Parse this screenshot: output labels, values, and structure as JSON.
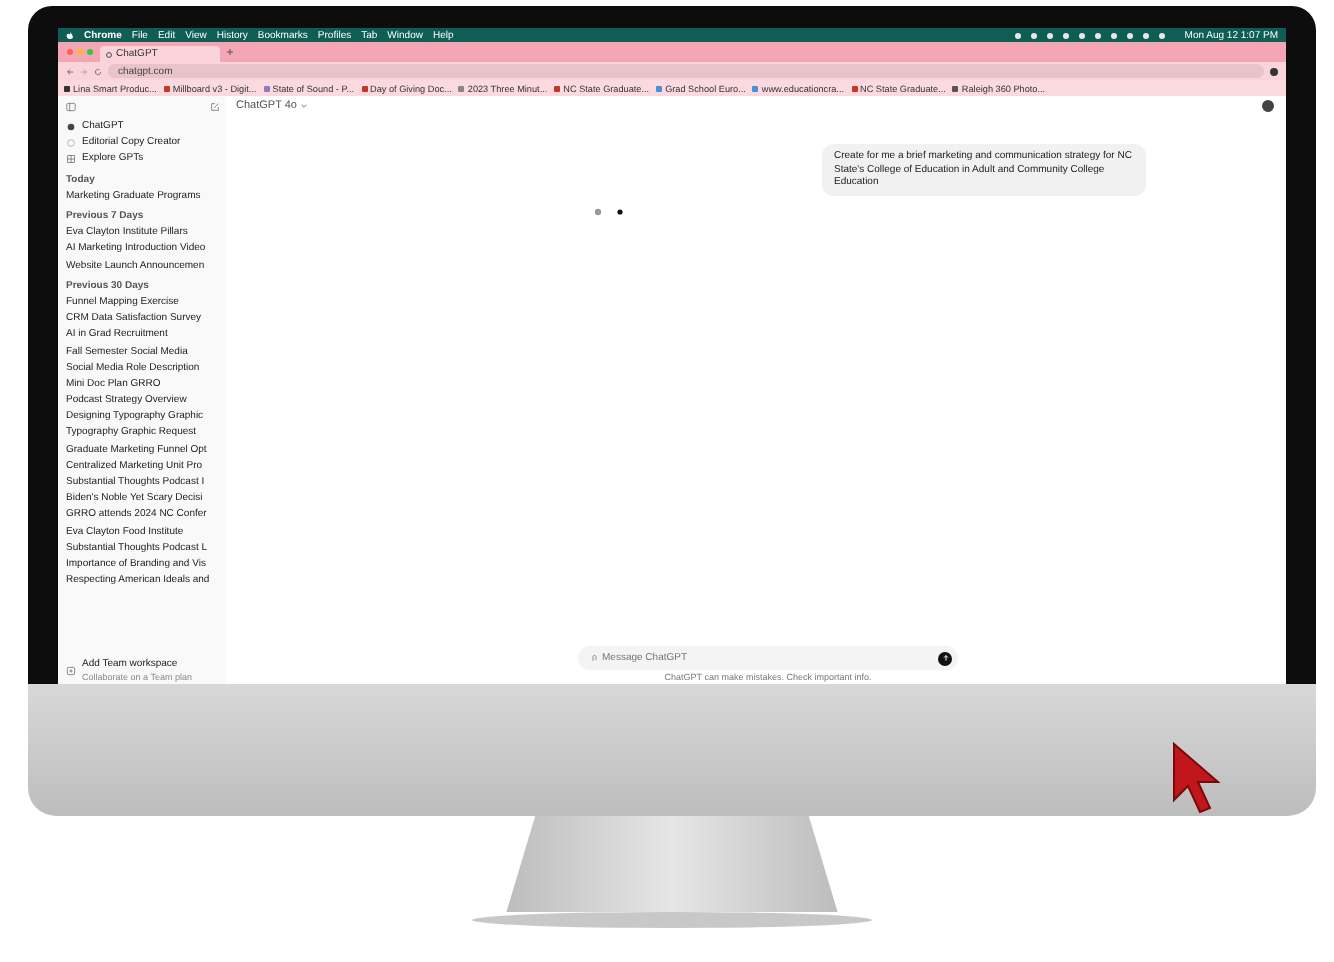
{
  "menu_bar": {
    "items": [
      "Chrome",
      "File",
      "Edit",
      "View",
      "History",
      "Bookmarks",
      "Profiles",
      "Tab",
      "Window",
      "Help"
    ],
    "clock": "Mon Aug 12 1:07 PM"
  },
  "browser": {
    "tab": {
      "title": "ChatGPT"
    },
    "url": "chatgpt.com",
    "bookmarks": [
      "Lina Smart Produc...",
      "Millboard v3 - Digit...",
      "State of Sound - P...",
      "Day of Giving Doc...",
      "2023 Three Minut...",
      "NC State Graduate...",
      "Grad School Euro...",
      "www.educationcra...",
      "NC State Graduate...",
      "Raleigh 360 Photo..."
    ]
  },
  "sidebar": {
    "top_items": [
      "ChatGPT",
      "Editorial Copy Creator",
      "Explore GPTs"
    ],
    "sections": [
      {
        "heading": "Today",
        "items": [
          "Marketing Graduate Programs"
        ]
      },
      {
        "heading": "Previous 7 Days",
        "items": [
          "Eva Clayton Institute Pillars",
          "AI Marketing Introduction Video",
          "Website Launch Announcemen"
        ]
      },
      {
        "heading": "Previous 30 Days",
        "items": [
          "Funnel Mapping Exercise",
          "CRM Data Satisfaction Survey",
          "AI in Grad Recruitment",
          "Fall Semester Social Media",
          "Social Media Role Description",
          "Mini Doc Plan GRRO",
          "Podcast Strategy Overview",
          "Designing Typography Graphic",
          "Typography Graphic Request",
          "Graduate Marketing Funnel Opt",
          "Centralized Marketing Unit Pro",
          "Substantial Thoughts Podcast I",
          "Biden's Noble Yet Scary Decisi",
          "GRRO attends 2024 NC Confer",
          "Eva Clayton Food Institute",
          "Substantial Thoughts Podcast L",
          "Importance of Branding and Vis",
          "Respecting American Ideals and"
        ]
      }
    ],
    "team": {
      "title": "Add Team workspace",
      "subtitle": "Collaborate on a Team plan"
    }
  },
  "chat": {
    "model": "ChatGPT 4o",
    "user_message": "Create for me a brief marketing and communication strategy for NC State's College of Education in Adult and Community College Education",
    "composer": {
      "placeholder": "Message ChatGPT"
    },
    "footer": "ChatGPT can make mistakes. Check important info."
  }
}
